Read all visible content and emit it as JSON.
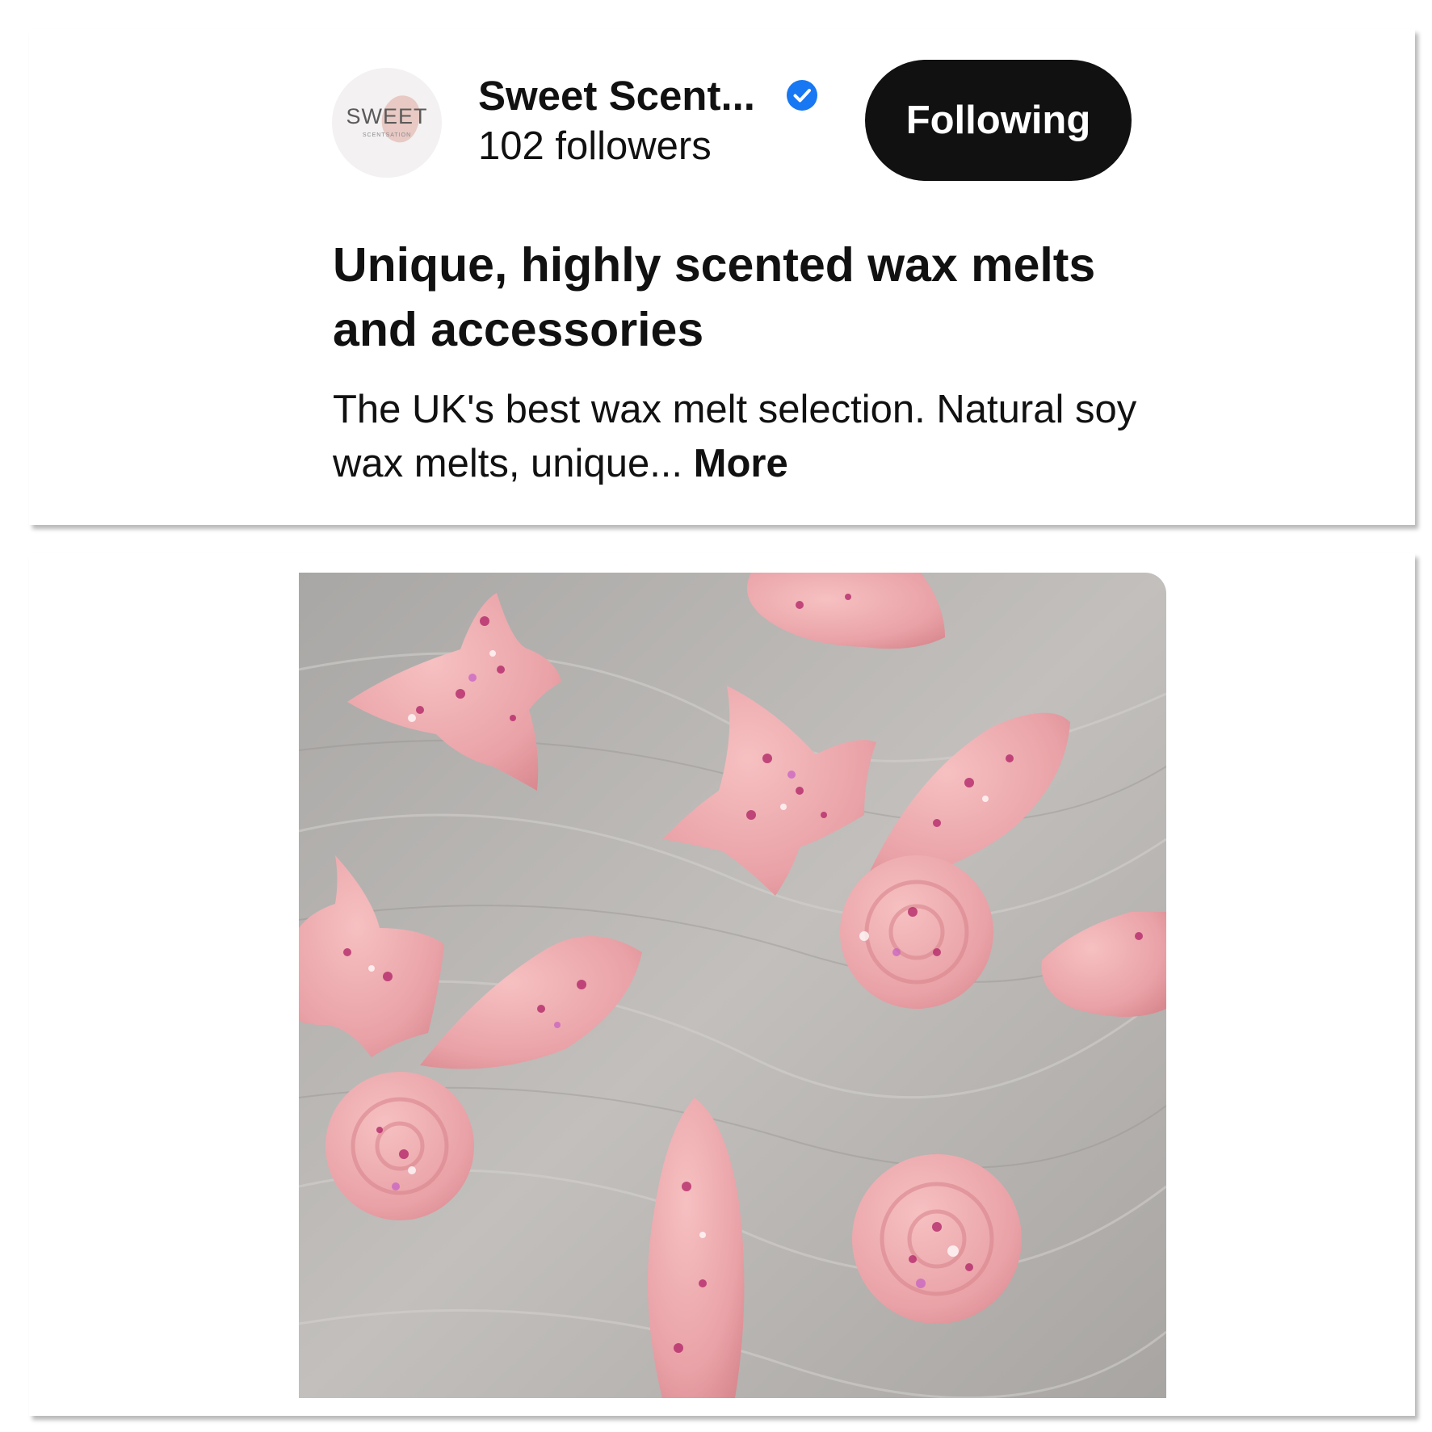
{
  "profile": {
    "avatar_text": "SWEET",
    "avatar_subtext": "SCENTSATION",
    "name": "Sweet Scent...",
    "verified_icon": "verified-badge-icon",
    "followers": "102 followers",
    "follow_button_label": "Following",
    "headline": "Unique, highly scented wax melts and accessories",
    "bio": "The UK's best wax melt selection. Natural soy wax melts, unique...",
    "more_label": "More"
  },
  "pin_image": {
    "subject": "pink wax melts with glitter on grey stone surface"
  },
  "colors": {
    "button_bg": "#111111",
    "button_text": "#ffffff",
    "verified_blue": "#1877f2",
    "wax_pink": "#e9a3a8",
    "stone_grey": "#b3b0ac"
  }
}
